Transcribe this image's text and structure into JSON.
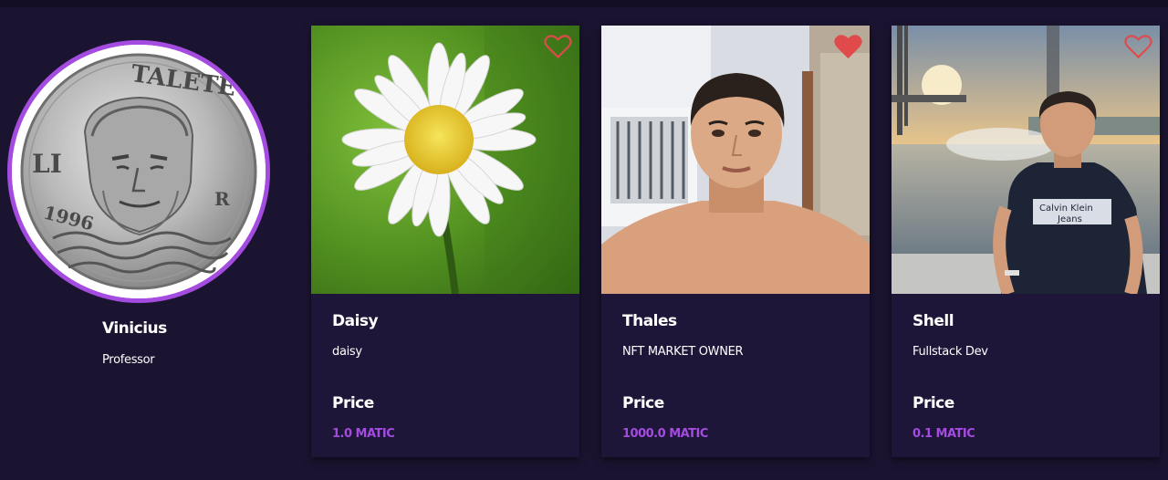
{
  "colors": {
    "background": "#1b1431",
    "card_background": "#1e1638",
    "avatar_border": "#a44be0",
    "price_accent": "#a44be0",
    "heart_red": "#e04a4a"
  },
  "profile": {
    "name": "Vinicius",
    "role": "Professor",
    "avatar_icon": "coin-portrait-image",
    "coin_inscription": "TALETE",
    "coin_denomination": "LI",
    "coin_year": "1996",
    "coin_mint_mark": "R"
  },
  "cards": [
    {
      "title": "Daisy",
      "description": "daisy",
      "price_label": "Price",
      "price": "1.0 MATIC",
      "liked": false,
      "image_icon": "daisy-flower-image"
    },
    {
      "title": "Thales",
      "description": "NFT MARKET OWNER",
      "price_label": "Price",
      "price": "1000.0 MATIC",
      "liked": true,
      "image_icon": "portrait-photo-image"
    },
    {
      "title": "Shell",
      "description": "Fullstack Dev",
      "price_label": "Price",
      "price": "0.1 MATIC",
      "liked": false,
      "image_icon": "outdoor-portrait-image"
    }
  ]
}
